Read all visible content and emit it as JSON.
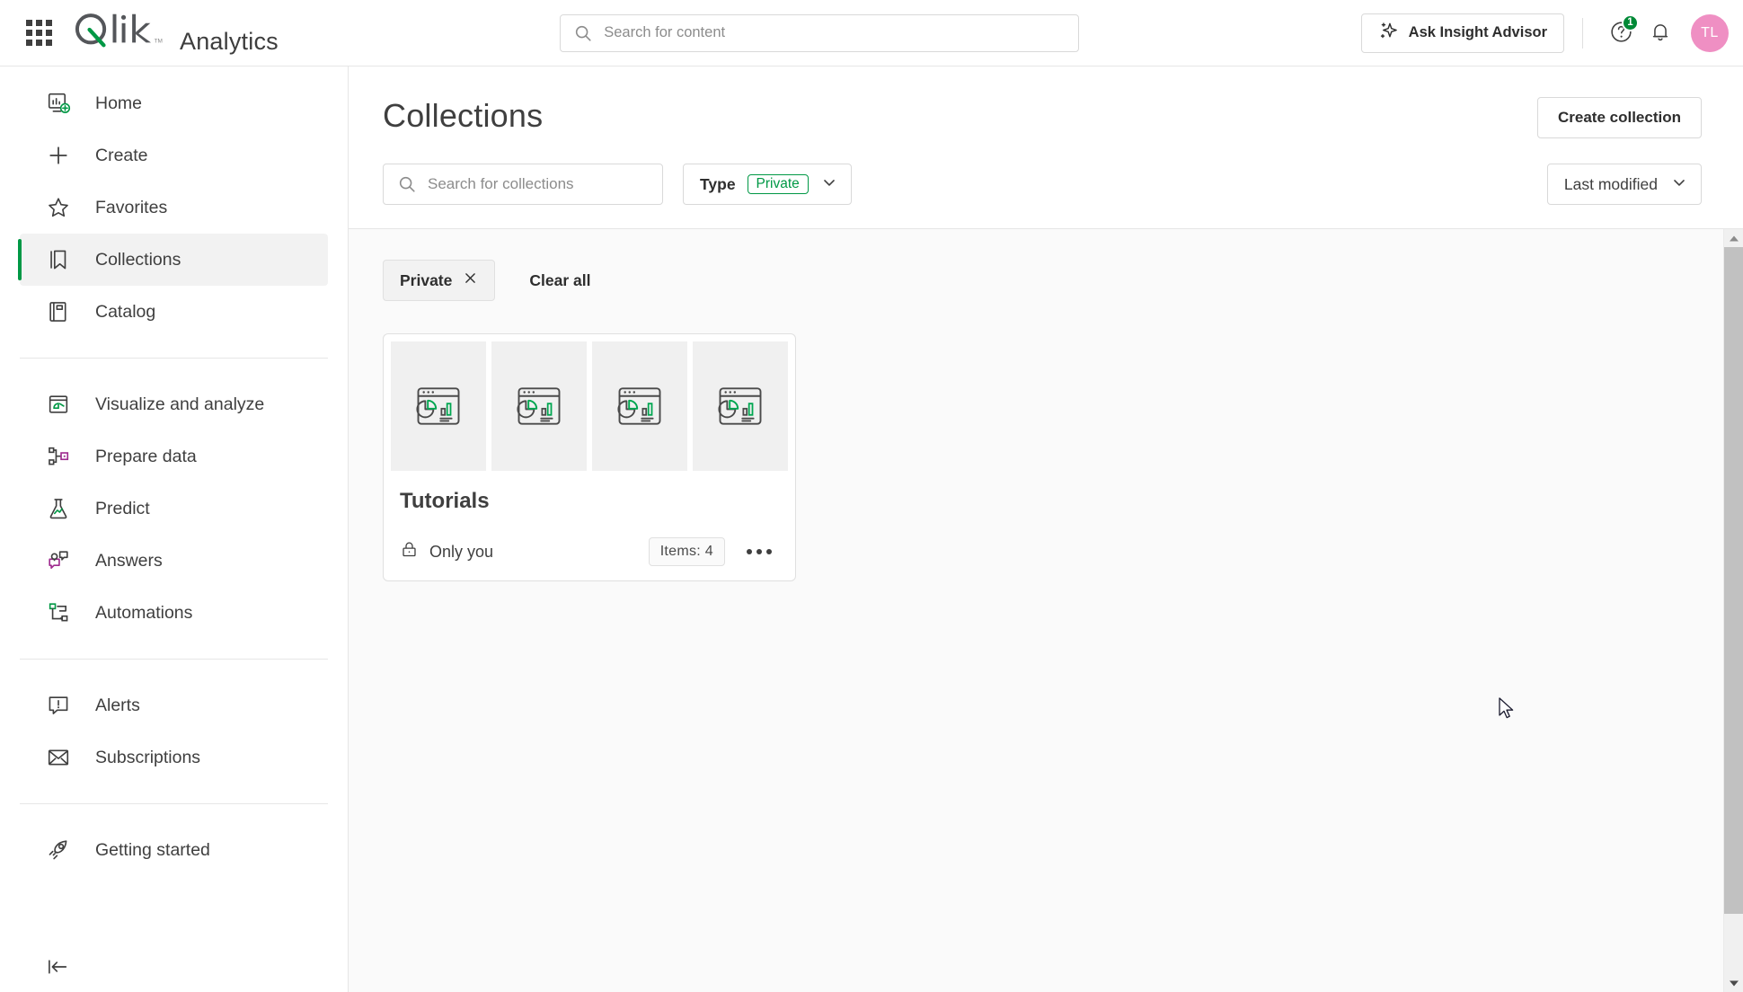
{
  "topbar": {
    "waffle_label": "App switcher",
    "brand": "Qlik",
    "product": "Analytics",
    "search": {
      "value": "",
      "placeholder": "Search for content"
    },
    "insight_advisor_label": "Ask Insight Advisor",
    "help_badge": "1",
    "avatar_initials": "TL"
  },
  "sidebar": {
    "items": [
      {
        "label": "Home",
        "icon": "home-insights-icon",
        "active": false
      },
      {
        "label": "Create",
        "icon": "plus-icon",
        "active": false
      },
      {
        "label": "Favorites",
        "icon": "star-icon",
        "active": false
      },
      {
        "label": "Collections",
        "icon": "bookmark-icon",
        "active": true
      },
      {
        "label": "Catalog",
        "icon": "catalog-book-icon",
        "active": false
      },
      {
        "label": "Visualize and analyze",
        "icon": "visualize-chart-icon",
        "active": false
      },
      {
        "label": "Prepare data",
        "icon": "prepare-data-icon",
        "active": false
      },
      {
        "label": "Predict",
        "icon": "flask-predict-icon",
        "active": false
      },
      {
        "label": "Answers",
        "icon": "answers-chat-icon",
        "active": false
      },
      {
        "label": "Automations",
        "icon": "automations-flow-icon",
        "active": false
      },
      {
        "label": "Alerts",
        "icon": "alert-bubble-icon",
        "active": false
      },
      {
        "label": "Subscriptions",
        "icon": "envelope-icon",
        "active": false
      },
      {
        "label": "Getting started",
        "icon": "rocket-icon",
        "active": false
      }
    ],
    "collapse_label": "Collapse navigation"
  },
  "main": {
    "page_title": "Collections",
    "create_collection_label": "Create collection",
    "search": {
      "value": "",
      "placeholder": "Search for collections"
    },
    "type_filter": {
      "label": "Type",
      "value": "Private"
    },
    "sort": {
      "value": "Last modified"
    },
    "active_filters": [
      {
        "label": "Private"
      }
    ],
    "clear_all_label": "Clear all",
    "collections": [
      {
        "title": "Tutorials",
        "owner": "Only you",
        "items_badge": "Items: 4",
        "thumbnails": 4,
        "more_label": "More actions"
      }
    ]
  },
  "colors": {
    "accent_green": "#009845",
    "badge_green": "#008936",
    "avatar_pink": "#ef8fc3",
    "magenta": "#9f2b8f",
    "text": "#3f3f3f",
    "border": "#e0e0e0"
  }
}
